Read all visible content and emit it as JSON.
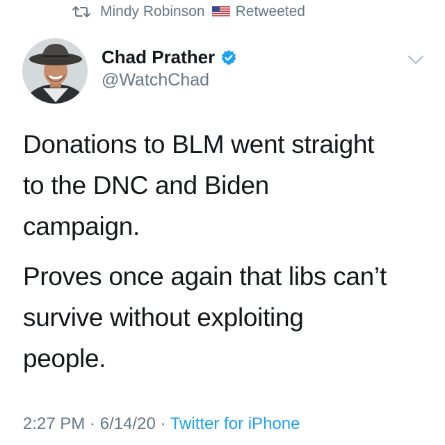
{
  "retweet": {
    "icon": "retweet-icon",
    "user": "Mindy Robinson",
    "flag_icon": "us-flag-icon",
    "label": "Retweeted"
  },
  "author": {
    "avatar": "profile-avatar",
    "display_name": "Chad Prather",
    "verified_icon": "verified-badge-icon",
    "handle": "@WatchChad",
    "menu_icon": "chevron-down-icon"
  },
  "tweet": {
    "paragraphs": [
      "Donations to BLM went straight\nto the DNC and Biden\ncampaign.",
      "Proves once again that libs can’t\nsurvive without exploiting\npeople."
    ]
  },
  "meta": {
    "time": "2:27 PM",
    "separator_1": " · ",
    "date": "6/14/20",
    "separator_2": " · ",
    "source": "Twitter for iPhone"
  },
  "colors": {
    "text": "#14171a",
    "secondary": "#657786",
    "accent": "#1da1f2"
  }
}
